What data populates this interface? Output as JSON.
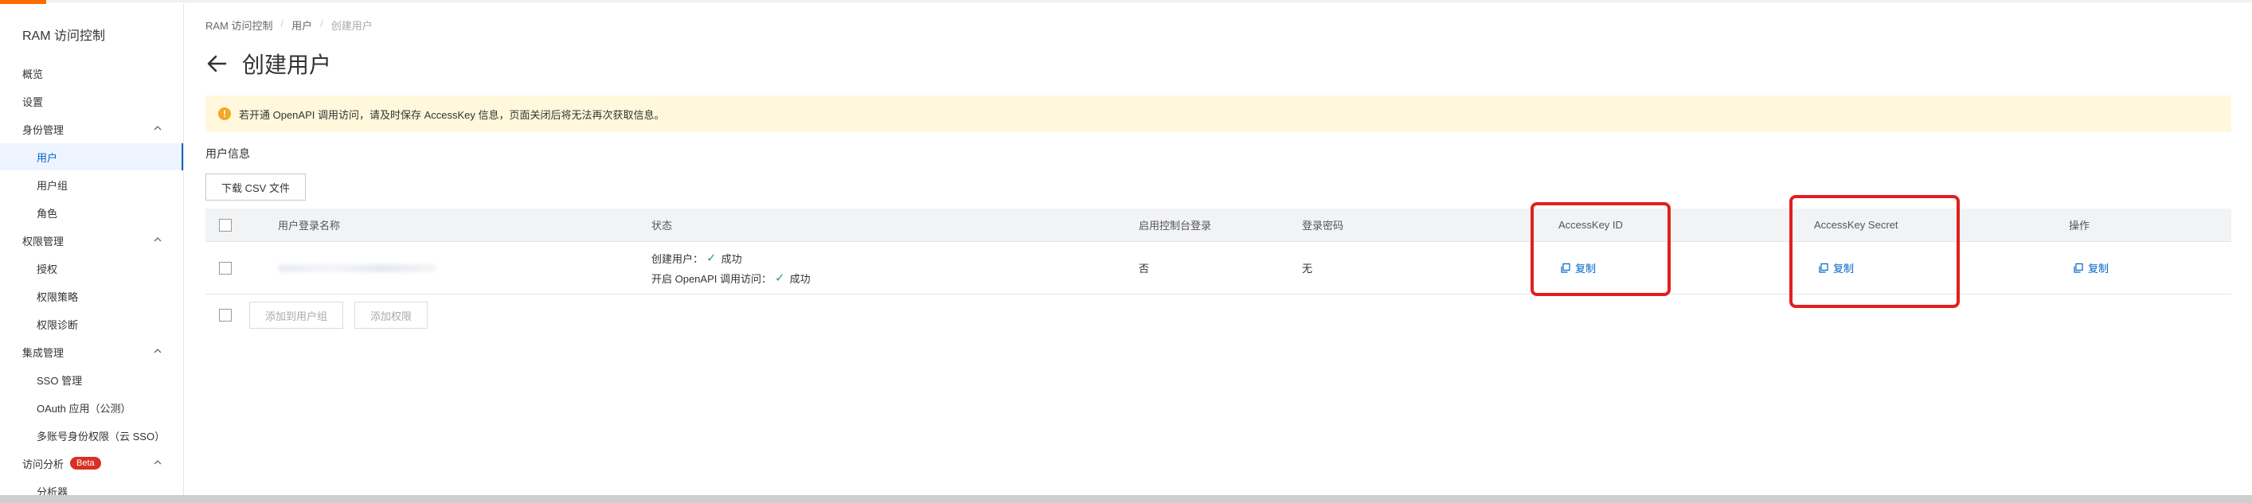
{
  "sidebar": {
    "title": "RAM 访问控制",
    "items": [
      {
        "label": "概览"
      },
      {
        "label": "设置"
      },
      {
        "label": "身份管理"
      },
      {
        "label": "用户"
      },
      {
        "label": "用户组"
      },
      {
        "label": "角色"
      },
      {
        "label": "权限管理"
      },
      {
        "label": "授权"
      },
      {
        "label": "权限策略"
      },
      {
        "label": "权限诊断"
      },
      {
        "label": "集成管理"
      },
      {
        "label": "SSO 管理"
      },
      {
        "label": "OAuth 应用（公测）"
      },
      {
        "label": "多账号身份权限（云 SSO）"
      },
      {
        "label": "访问分析"
      },
      {
        "label": "分析器"
      }
    ],
    "beta_badge": "Beta"
  },
  "breadcrumb": {
    "items": [
      "RAM 访问控制",
      "用户",
      "创建用户"
    ],
    "separator": "/"
  },
  "page": {
    "title": "创建用户"
  },
  "alert": {
    "icon": "warning-icon",
    "text": "若开通 OpenAPI 调用访问，请及时保存 AccessKey 信息，页面关闭后将无法再次获取信息。"
  },
  "section": {
    "title": "用户信息",
    "download_button": "下载 CSV 文件"
  },
  "table": {
    "headers": [
      "用户登录名称",
      "状态",
      "启用控制台登录",
      "登录密码",
      "AccessKey ID",
      "AccessKey Secret",
      "操作"
    ],
    "rows": [
      {
        "status_create_label": "创建用户：",
        "status_create_value": "成功",
        "status_api_label": "开启 OpenAPI 调用访问：",
        "status_api_value": "成功",
        "console_login": "否",
        "password": "无",
        "accesskey_id_action": "复制",
        "accesskey_secret_action": "复制",
        "operation_action": "复制"
      }
    ]
  },
  "footer": {
    "add_to_group": "添加到用户组",
    "add_permission": "添加权限"
  },
  "colors": {
    "accent": "#ff6a00",
    "link": "#0064c8",
    "highlight": "#e02020",
    "alert_bg": "#fff8dc"
  }
}
